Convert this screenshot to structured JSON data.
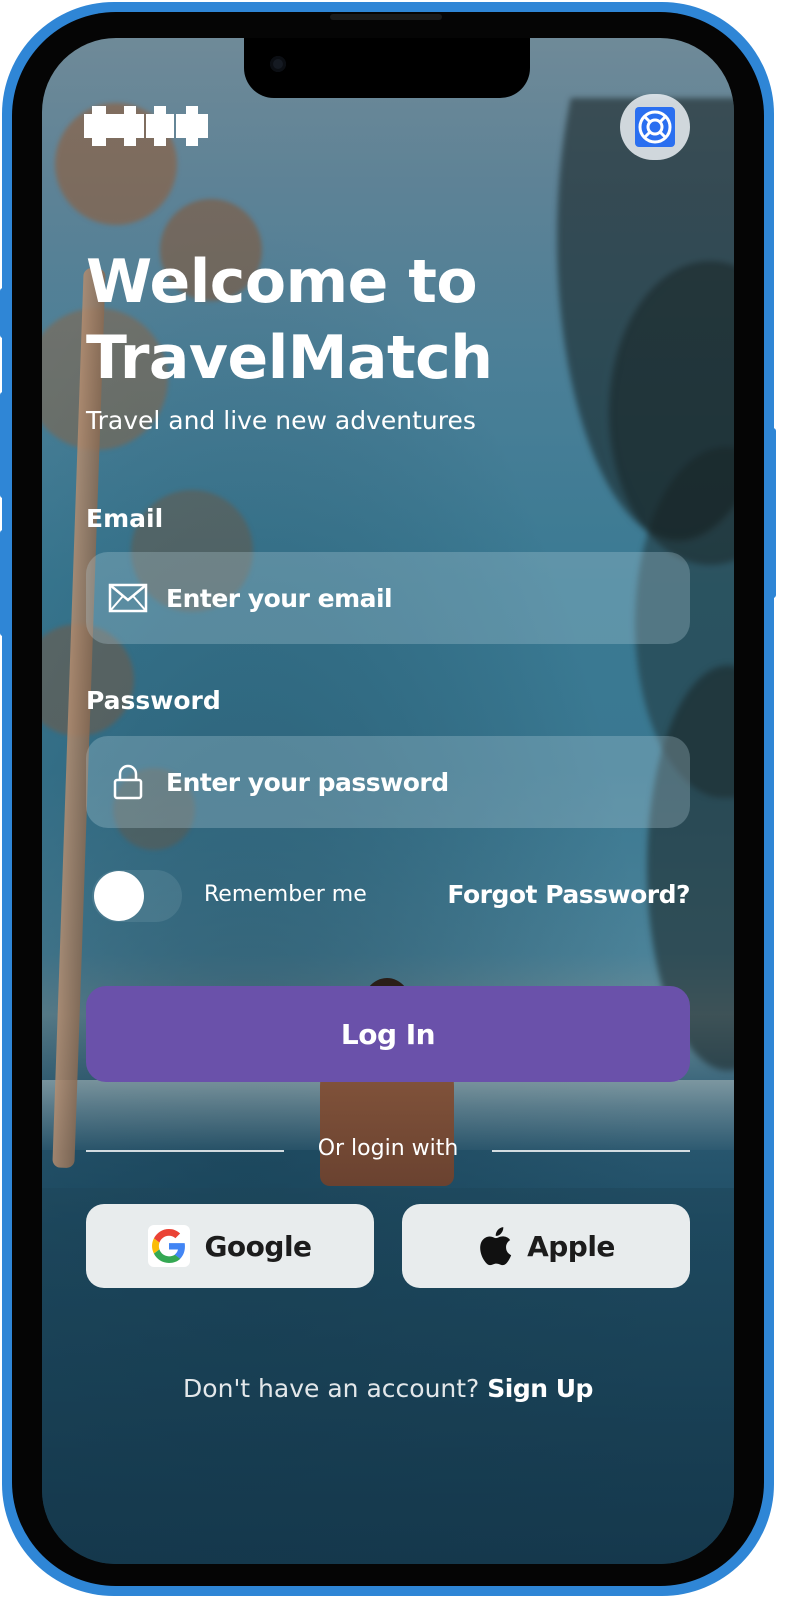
{
  "header": {
    "logo_icon": "travelmatch-logo-icon",
    "support_icon": "lifebuoy-icon"
  },
  "hero": {
    "title_line1": "Welcome to",
    "title_line2": "TravelMatch",
    "subtitle": "Travel and live new adventures"
  },
  "form": {
    "email": {
      "label": "Email",
      "placeholder": "Enter your email",
      "value": "",
      "icon": "mail-icon"
    },
    "password": {
      "label": "Password",
      "placeholder": "Enter your password",
      "value": "",
      "icon": "lock-icon"
    },
    "remember_me": {
      "label": "Remember me",
      "checked": false
    },
    "forgot_password": "Forgot Password?",
    "login_button": "Log In"
  },
  "social": {
    "divider_text": "Or login with",
    "google": {
      "label": "Google",
      "icon": "google-icon"
    },
    "apple": {
      "label": "Apple",
      "icon": "apple-icon"
    }
  },
  "footer": {
    "prompt": "Don't have an account?",
    "signup_link": "Sign Up"
  },
  "colors": {
    "accent": "#6a51aa",
    "phone_frame": "#2f86d6",
    "text": "#ffffff"
  }
}
